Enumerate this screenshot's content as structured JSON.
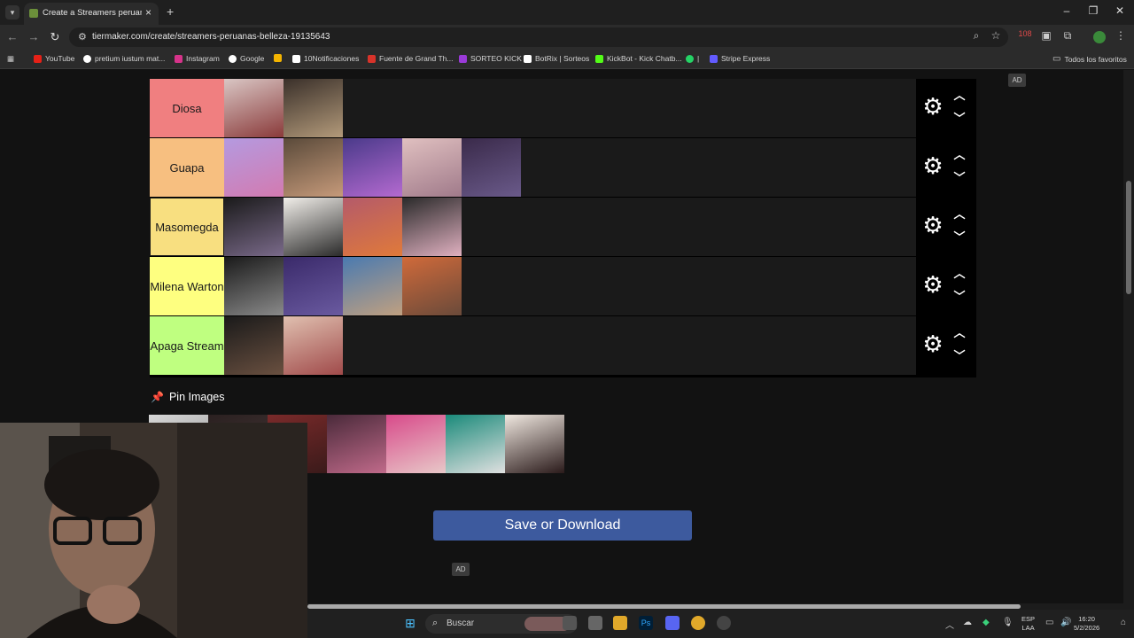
{
  "browser": {
    "tab_title": "Create a Streamers peruanas be",
    "url": "tiermaker.com/create/streamers-peruanas-belleza-19135643",
    "bookmarks": [
      {
        "label": "YouTube",
        "color": "#e62117"
      },
      {
        "label": "pretium iustum mat...",
        "color": "#ffffff"
      },
      {
        "label": "Instagram",
        "color": "#d6338a"
      },
      {
        "label": "Google",
        "color": "#ffffff"
      },
      {
        "label": "",
        "color": "#f4b400"
      },
      {
        "label": "10Notificaciones",
        "color": "#ffffff"
      },
      {
        "label": "Fuente de Grand Th...",
        "color": "#d8332a"
      },
      {
        "label": "SORTEO KICK",
        "color": "#9a3ad8"
      },
      {
        "label": "BotRix | Sorteos",
        "color": "#ffffff"
      },
      {
        "label": "KickBot - Kick Chatb...",
        "color": "#53fc18"
      },
      {
        "label": "|",
        "color": "#25d366"
      },
      {
        "label": "Stripe Express",
        "color": "#635bff"
      }
    ],
    "all_bookmarks": "Todos los favoritos",
    "profile_badge": "108"
  },
  "page": {
    "ad_label": "AD",
    "tiers": [
      {
        "label": "Diosa",
        "color": "#f07f80",
        "images": [
          [
            "#d9c6c4",
            "#8a3a3a"
          ],
          [
            "#3a302a",
            "#b39a7a"
          ]
        ]
      },
      {
        "label": "Guapa",
        "color": "#f7bf80",
        "images": [
          [
            "#b49ae0",
            "#d37ab0"
          ],
          [
            "#5a4a3a",
            "#c69a7a"
          ],
          [
            "#4a3a8a",
            "#b46ad0"
          ],
          [
            "#e0c0c0",
            "#a07a8a"
          ],
          [
            "#3a2a4a",
            "#6a5a8a"
          ]
        ]
      },
      {
        "label": "Masomegda",
        "color": "#f8df80",
        "images": [
          [
            "#1a1a1a",
            "#7a6a8a"
          ],
          [
            "#f2efea",
            "#2a2a2a"
          ],
          [
            "#b45a6a",
            "#e07a3a"
          ],
          [
            "#2a2a2a",
            "#e0b0c0"
          ]
        ]
      },
      {
        "label": "Milena Warton",
        "color": "#feff80",
        "images": [
          [
            "#1a1a1a",
            "#8a8a8a"
          ],
          [
            "#3a2a6a",
            "#6a5aa0"
          ],
          [
            "#4a7ab0",
            "#c0a080"
          ],
          [
            "#d06a3a",
            "#6a4a3a"
          ]
        ]
      },
      {
        "label": "Apaga Stream",
        "color": "#bfff80",
        "images": [
          [
            "#1a1a1a",
            "#6a5040"
          ],
          [
            "#e0c0b0",
            "#a04a4a"
          ]
        ]
      }
    ],
    "pin_label": "Pin Images",
    "pool_images": [
      [
        "#d8d8d8",
        "#8a8a8a"
      ],
      [
        "#2a2020",
        "#4a3a3a"
      ],
      [
        "#7a2a2a",
        "#3a1a1a"
      ],
      [
        "#4a2a3a",
        "#c06a8a"
      ],
      [
        "#d84a8a",
        "#e8c8c8"
      ],
      [
        "#1a8a7a",
        "#e0e0e0"
      ],
      [
        "#f0e8e0",
        "#2a1a1a"
      ]
    ],
    "save_button": "Save or Download"
  },
  "taskbar": {
    "search_placeholder": "Buscar",
    "lang_line1": "ESP",
    "lang_line2": "LAA",
    "time": "16:20",
    "date": "5/2/2026"
  }
}
